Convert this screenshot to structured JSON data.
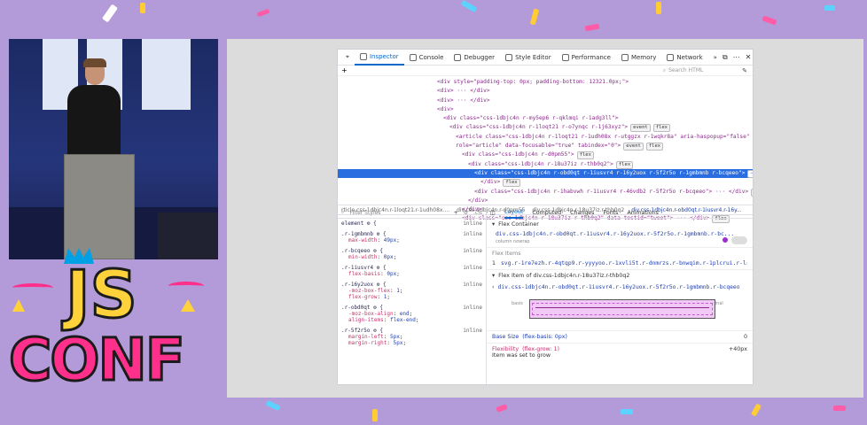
{
  "devtools": {
    "tabs": [
      {
        "label": "Inspector"
      },
      {
        "label": "Console"
      },
      {
        "label": "Debugger"
      },
      {
        "label": "Style Editor"
      },
      {
        "label": "Performance"
      },
      {
        "label": "Memory"
      },
      {
        "label": "Network"
      }
    ],
    "more_tabs": "»",
    "search_placeholder": "Search HTML",
    "add_node": "+",
    "markup": [
      {
        "text": "<div style=\"padding-top: 0px; padding-bottom: 12321.0px;\">",
        "indent": 0
      },
      {
        "text": "<div> ··· </div>",
        "indent": 0
      },
      {
        "text": "<div> ··· </div>",
        "indent": 0
      },
      {
        "text": "<div>",
        "indent": 0
      },
      {
        "text": "<div class=\"css-1dbjc4n r-my5ep6 r-qklmqi r-1adg3ll\">",
        "indent": 1
      },
      {
        "text": "<div class=\"css-1dbjc4n r-1loqt21 r-o7ynqc r-1j63xyz\">",
        "indent": 2,
        "badges": [
          "event",
          "flex"
        ]
      },
      {
        "text": "<article class=\"css-1dbjc4n r-1loqt21 r-1udh08x r-utggzx r-1wqkr8a\" aria-haspopup=\"false\"",
        "indent": 3
      },
      {
        "text": "role=\"article\" data-focusable=\"true\" tabindex=\"0\">",
        "indent": 3,
        "badges": [
          "event",
          "flex"
        ]
      },
      {
        "text": "<div class=\"css-1dbjc4n r-d0pm55\">",
        "indent": 4,
        "badges": [
          "flex"
        ]
      },
      {
        "text": "<div class=\"css-1dbjc4n r-18u37iz r-thb0q2\">",
        "indent": 5,
        "badges": [
          "flex"
        ]
      },
      {
        "text": "<div class=\"css-1dbjc4n r-obd0qt r-1iusvr4 r-16y2uox r-5f2r5o r-1gmbmnb r-bcqeeo\">",
        "indent": 6,
        "selected": true,
        "badges": [
          "⋯"
        ]
      },
      {
        "text": "</div>",
        "indent": 7,
        "badges": [
          "flex"
        ]
      },
      {
        "text": "<div class=\"css-1dbjc4n r-1habvwh r-1iusvr4 r-46vdb2 r-5f2r5o r-bcqeeo\"> ··· </div>",
        "indent": 6,
        "badges": [
          "flex"
        ]
      },
      {
        "text": "</div>",
        "indent": 5
      },
      {
        "text": "</div>",
        "indent": 4
      },
      {
        "text": "<div class=\"css-1dbjc4n r-18u37iz r-thb0q2\" data-testid=\"tweet\"> ··· </div>",
        "indent": 4,
        "badges": [
          "flex"
        ]
      }
    ],
    "breadcrumbs": [
      "rticle.css-1dbjc4n.r-1loqt21.r-1udh08x....",
      "div.css-1dbjc4n.r-d0pm55",
      "div.css-1dbjc4n.r-18u37iz.r-thb0q2",
      "div.css-1dbjc4n.r-obd0qt.r-1iusvr4.r-16y..."
    ],
    "rules_filter": "Filter Styles",
    "rules_cls": ".cls",
    "rules": [
      {
        "selector": "element ⚙ {",
        "source": "inline",
        "decls": []
      },
      {
        "selector": ".r-1gmbmnb ⚙ {",
        "source": "inline",
        "decls": [
          {
            "p": "max-width",
            "v": "49px"
          }
        ]
      },
      {
        "selector": ".r-bcqeeo ⚙ {",
        "source": "inline",
        "decls": [
          {
            "p": "min-width",
            "v": "0px"
          }
        ]
      },
      {
        "selector": ".r-1iusvr4 ⚙ {",
        "source": "inline",
        "decls": [
          {
            "p": "flex-basis",
            "v": "0px"
          }
        ]
      },
      {
        "selector": ".r-16y2uox ⚙ {",
        "source": "inline",
        "decls": [
          {
            "p": "-moz-box-flex",
            "v": "1"
          },
          {
            "p": "flex-grow",
            "v": "1"
          }
        ]
      },
      {
        "selector": ".r-obd0qt ⚙ {",
        "source": "inline",
        "decls": [
          {
            "p": "-moz-box-align",
            "v": "end"
          },
          {
            "p": "align-items",
            "v": "flex-end"
          }
        ]
      },
      {
        "selector": ".r-5f2r5o ⚙ {",
        "source": "inline",
        "decls": [
          {
            "p": "margin-left",
            "v": "5px"
          },
          {
            "p": "margin-right",
            "v": "5px"
          }
        ]
      }
    ],
    "layout_tabs": [
      "Layout",
      "Computed",
      "Changes",
      "Fonts",
      "Animations"
    ],
    "flex_container": {
      "title": "Flex Container",
      "selector": "div.css-1dbjc4n.r-obd0qt.r-1iusvr4.r-16y2uox.r-5f2r5o.r-1gmbmnb.r-bc...",
      "meta": "column  nowrap",
      "items_title": "Flex Items",
      "item_index": "1",
      "item_selector": "svg.r-1re7ezh.r-4qtqp9.r-yyyyoo.r-1xvli5t.r-dnmrzs.r-bnwqim.r-1plcrui.r-lr..."
    },
    "flex_item": {
      "title": "Flex Item of div.css-1dbjc4n.r-18u37iz.r-thb0q2",
      "selector": "div.css-1dbjc4n.r-obd0qt.r-1iusvr4.r-16y2uox.r-5f2r5o.r-1gmbmnb.r-bcqeeo",
      "basis_label": "basis",
      "final_label": "final",
      "base_size_label": "Base Size",
      "base_size_note": "(flex-basis: 0px)",
      "base_size_value": "0",
      "flexibility_label": "Flexibility",
      "flexibility_note": "(flex-grow: 1)",
      "flexibility_value": "+40px",
      "flexibility_desc": "Item was set to grow"
    }
  },
  "logo": {
    "line1": "JS",
    "line2": "CONF"
  },
  "colors": {
    "background": "#b39ad8",
    "accent": "#0a69c9",
    "selection": "#2a6de0"
  }
}
